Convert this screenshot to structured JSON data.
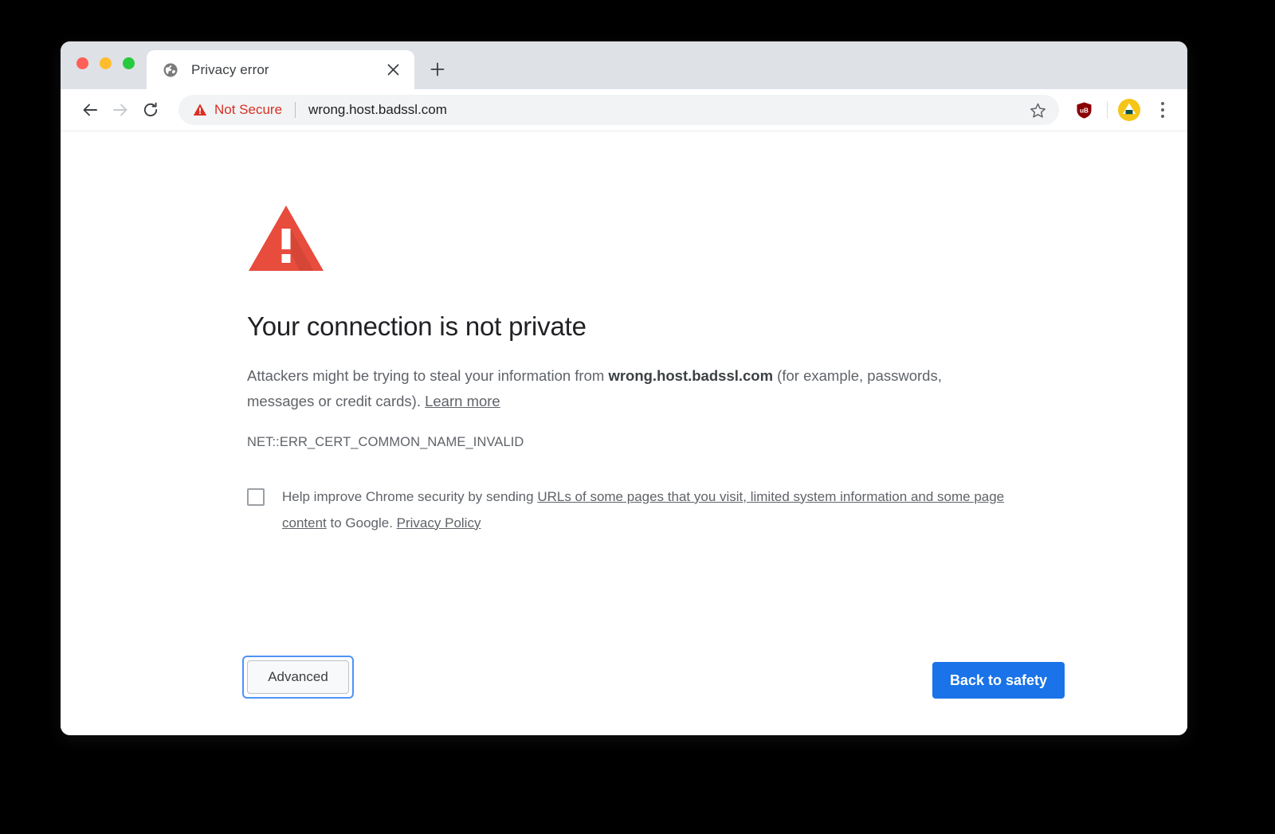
{
  "window": {
    "traffic_lights": [
      {
        "name": "close",
        "color": "#ff5f56"
      },
      {
        "name": "minimize",
        "color": "#ffbd2e"
      },
      {
        "name": "zoom",
        "color": "#27c93f"
      }
    ]
  },
  "tab": {
    "title": "Privacy error",
    "favicon": "globe-icon",
    "close_icon": "close-icon",
    "new_tab_icon": "plus-icon"
  },
  "toolbar": {
    "back_icon": "arrow-left-icon",
    "forward_icon": "arrow-right-icon",
    "reload_icon": "reload-icon",
    "security_icon": "warning-triangle-icon",
    "security_label": "Not Secure",
    "security_color": "#d93025",
    "url": "wrong.host.badssl.com",
    "bookmark_icon": "star-icon",
    "extension_icon": "ublock-origin-shield-icon",
    "extension_label": "uB",
    "profile_icon": "profile-avatar-icon",
    "menu_icon": "three-dots-menu-icon"
  },
  "interstitial": {
    "icon": "red-warning-triangle-icon",
    "icon_color": "#e74c3c",
    "headline": "Your connection is not private",
    "body_prefix": "Attackers might be trying to steal your information from ",
    "body_domain": "wrong.host.badssl.com",
    "body_suffix": " (for example, passwords, messages or credit cards). ",
    "learn_more": "Learn more",
    "error_code": "NET::ERR_CERT_COMMON_NAME_INVALID",
    "optin_prefix": "Help improve Chrome security by sending ",
    "optin_link1": "URLs of some pages that you visit, limited system information and some page content",
    "optin_middle": " to Google. ",
    "optin_link2": "Privacy Policy",
    "checkbox_checked": false
  },
  "footer": {
    "advanced_label": "Advanced",
    "back_to_safety_label": "Back to safety",
    "primary_color": "#1a73e8",
    "focus_ring_color": "#4f93f7"
  }
}
